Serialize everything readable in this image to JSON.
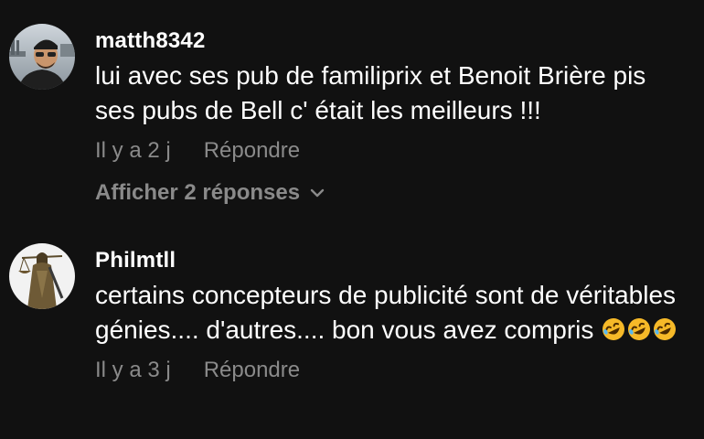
{
  "comments": [
    {
      "username": "matth8342",
      "text": "lui avec ses pub de familiprix et Benoit Brière pis ses pubs de Bell c' était les meilleurs !!!",
      "time": "Il y a 2 j",
      "reply_label": "Répondre",
      "view_replies_label": "Afficher 2 réponses",
      "avatar_icon": "person-photo-icon"
    },
    {
      "username": "Philmtll",
      "text": "certains concepteurs de publicité sont de véritables génies.... d'autres.... bon vous avez compris",
      "emoji_count": 3,
      "emoji_icon": "rolling-laughing-emoji-icon",
      "time": "Il y a 3 j",
      "reply_label": "Répondre",
      "avatar_icon": "lady-justice-statue-icon"
    }
  ],
  "colors": {
    "background": "#111111",
    "text_primary": "#ffffff",
    "text_secondary": "#8a8a8a"
  }
}
